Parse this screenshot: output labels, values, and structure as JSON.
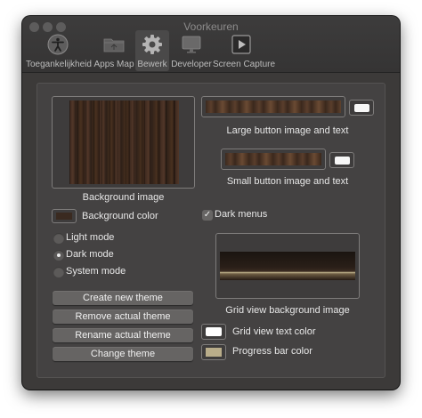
{
  "window": {
    "title": "Voorkeuren"
  },
  "toolbar": {
    "items": [
      {
        "label": "Toegankelijkheid",
        "icon": "accessibility-icon"
      },
      {
        "label": "Apps Map",
        "icon": "folder-icon"
      },
      {
        "label": "Bewerk",
        "icon": "gear-icon",
        "selected": true
      },
      {
        "label": "Developer",
        "icon": "monitor-icon"
      },
      {
        "label": "Screen Capture",
        "icon": "play-icon"
      }
    ]
  },
  "appearance": {
    "background_image_label": "Background image",
    "large_button_label": "Large button image and text",
    "small_button_label": "Small button image and text",
    "background_color_label": "Background color",
    "background_color": "#3a2a20",
    "dark_menus_label": "Dark menus",
    "dark_menus_checked": true,
    "modes": [
      {
        "label": "Light mode",
        "selected": false
      },
      {
        "label": "Dark mode",
        "selected": true
      },
      {
        "label": "System mode",
        "selected": false
      }
    ],
    "grid_view_background_label": "Grid view background image",
    "grid_view_text_color_label": "Grid view text color",
    "grid_view_text_color": "#ffffff",
    "progress_bar_color_label": "Progress bar color",
    "progress_bar_color": "#b9ad8a"
  },
  "buttons": {
    "create": "Create new theme",
    "remove": "Remove actual theme",
    "rename": "Rename actual theme",
    "change": "Change theme"
  }
}
